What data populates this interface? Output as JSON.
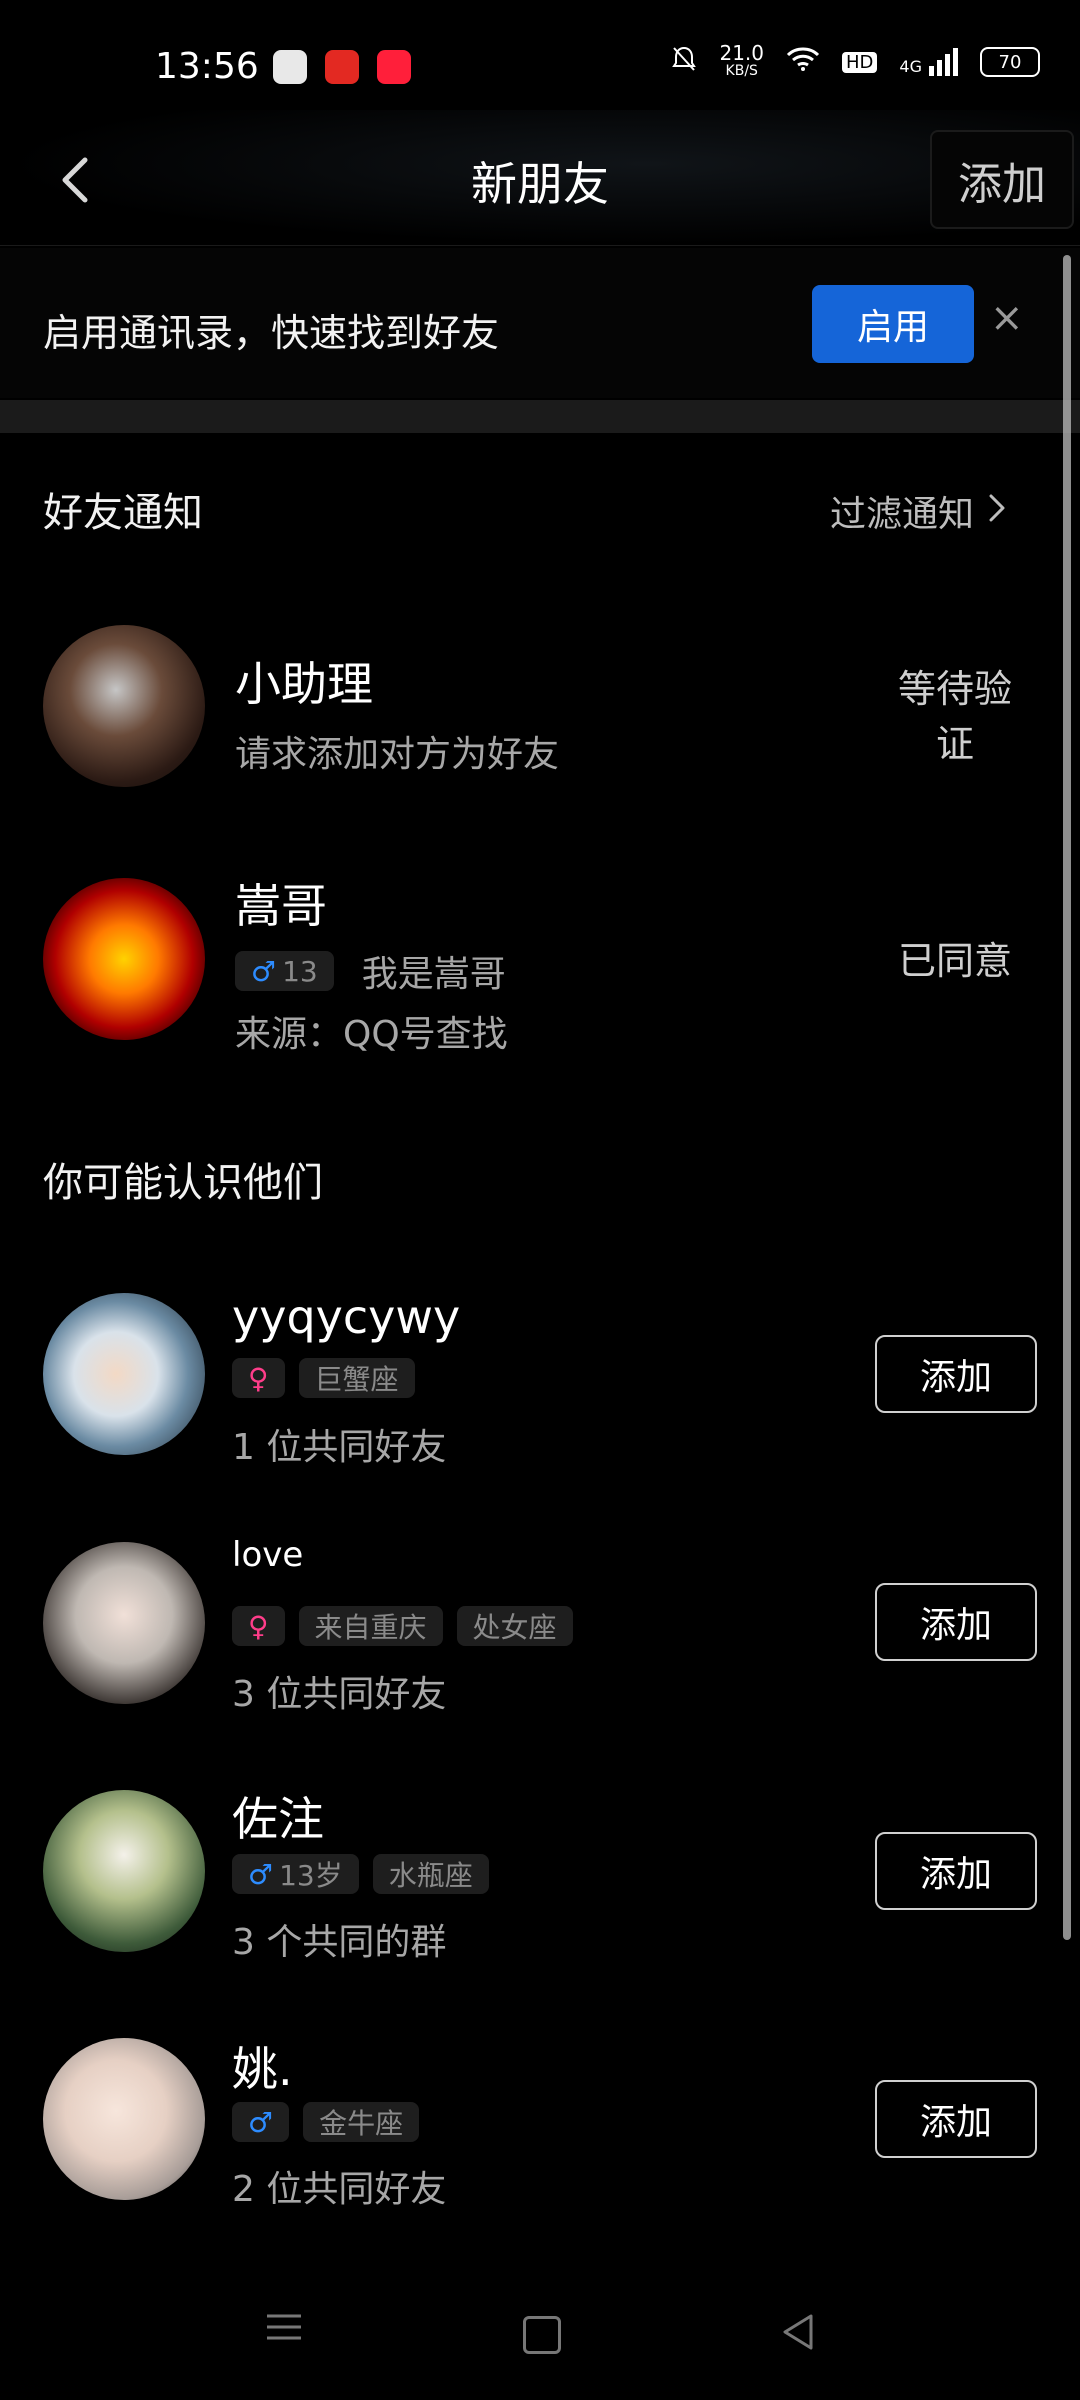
{
  "status_bar": {
    "time": "13:56",
    "network_speed_value": "21.0",
    "network_speed_unit": "KB/S",
    "hd": "HD",
    "signal_type": "4G",
    "battery": "70",
    "icons": [
      "wechat-icon",
      "app-icon-red-1",
      "app-icon-red-2",
      "bell-muted-icon",
      "wifi-icon",
      "signal-icon",
      "battery-icon"
    ]
  },
  "header": {
    "title": "新朋友",
    "add_label": "添加",
    "back_icon": "chevron-left-icon"
  },
  "banner": {
    "text": "启用通讯录，快速找到好友",
    "enable_label": "启用",
    "close_symbol": "×"
  },
  "friend_notifications": {
    "title": "好友通知",
    "filter_label": "过滤通知",
    "items": [
      {
        "name": "小助理",
        "message": "请求添加对方为好友",
        "status_line1": "等待验",
        "status_line2": "证"
      },
      {
        "name": "嵩哥",
        "age_tag": "13",
        "gender_symbol": "♂",
        "message": "我是嵩哥",
        "source": "来源：QQ号查找",
        "status": "已同意"
      }
    ]
  },
  "suggestions": {
    "title": "你可能认识他们",
    "add_label": "添加",
    "items": [
      {
        "name": "yyqycywy",
        "gender_symbol": "♀",
        "tag1": "巨蟹座",
        "mutual": "1 位共同好友"
      },
      {
        "name": "love",
        "gender_symbol": "♀",
        "tag1": "来自重庆",
        "tag2": "处女座",
        "mutual": "3 位共同好友"
      },
      {
        "name": "佐注",
        "gender_symbol": "♂",
        "age_tag": "13岁",
        "tag1": "水瓶座",
        "mutual": "3 个共同的群"
      },
      {
        "name": "姚.",
        "gender_symbol": "♂",
        "tag1": "金牛座",
        "mutual": "2 位共同好友"
      }
    ]
  },
  "colors": {
    "background": "#000000",
    "accent_blue": "#1565d8",
    "male": "#2d8cff",
    "female": "#ff3d8a",
    "text_secondary": "#a7a7a7"
  }
}
